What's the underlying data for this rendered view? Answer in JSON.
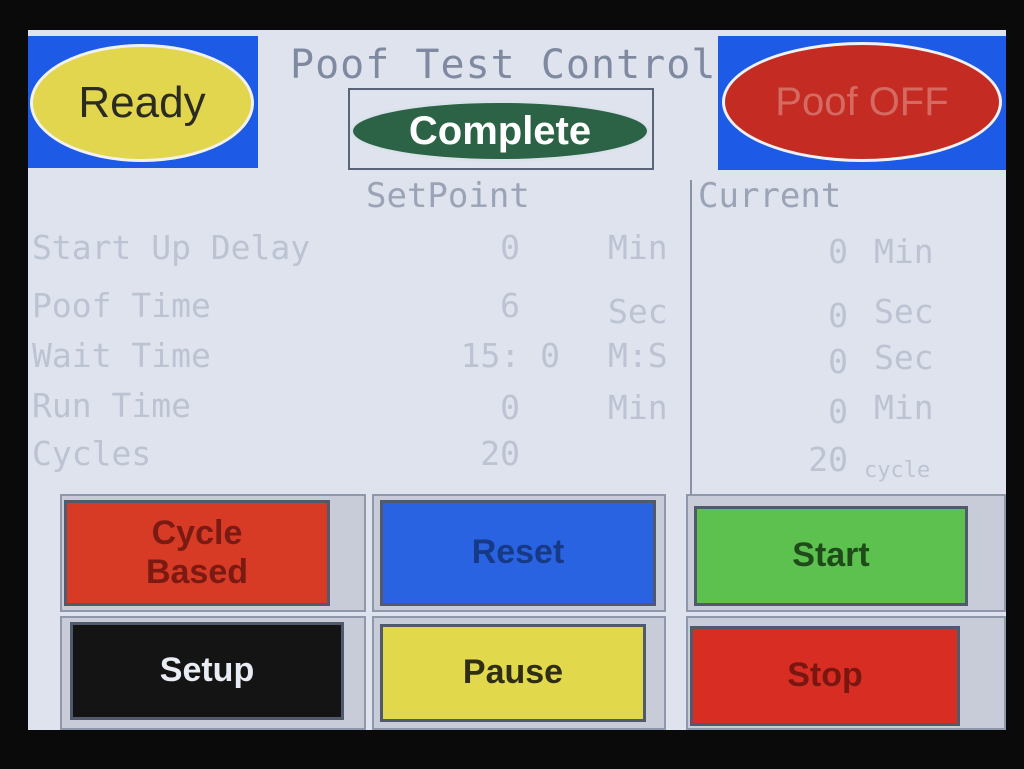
{
  "header": {
    "title": "Poof Test Control",
    "ready_label": "Ready",
    "complete_label": "Complete",
    "poof_label": "Poof OFF"
  },
  "columns": {
    "setpoint": "SetPoint",
    "current": "Current"
  },
  "rows": [
    {
      "label": "Start Up Delay",
      "setpoint": "0",
      "setpoint_unit": "Min",
      "current": "0",
      "current_unit": "Min"
    },
    {
      "label": "Poof Time",
      "setpoint": "6",
      "setpoint_unit": "Sec",
      "current": "0",
      "current_unit": "Sec"
    },
    {
      "label": "Wait Time",
      "setpoint": "15:  0",
      "setpoint_unit": "M:S",
      "current": "0",
      "current_unit": "Sec"
    },
    {
      "label": "Run Time",
      "setpoint": "0",
      "setpoint_unit": "Min",
      "current": "0",
      "current_unit": "Min"
    },
    {
      "label": "Cycles",
      "setpoint": "20",
      "setpoint_unit": "",
      "current": "20",
      "current_unit": "cycle"
    }
  ],
  "buttons": {
    "cycle_based_line1": "Cycle",
    "cycle_based_line2": "Based",
    "reset": "Reset",
    "start": "Start",
    "setup": "Setup",
    "pause": "Pause",
    "stop": "Stop"
  },
  "colors": {
    "ready": "#e1d64e",
    "complete": "#2c6246",
    "poof_off": "#c42b22",
    "cycle_based": "#d73a25",
    "reset": "#2a63e2",
    "start": "#5cc14e",
    "setup": "#141414",
    "pause": "#e2d84c",
    "stop": "#d82d22"
  }
}
